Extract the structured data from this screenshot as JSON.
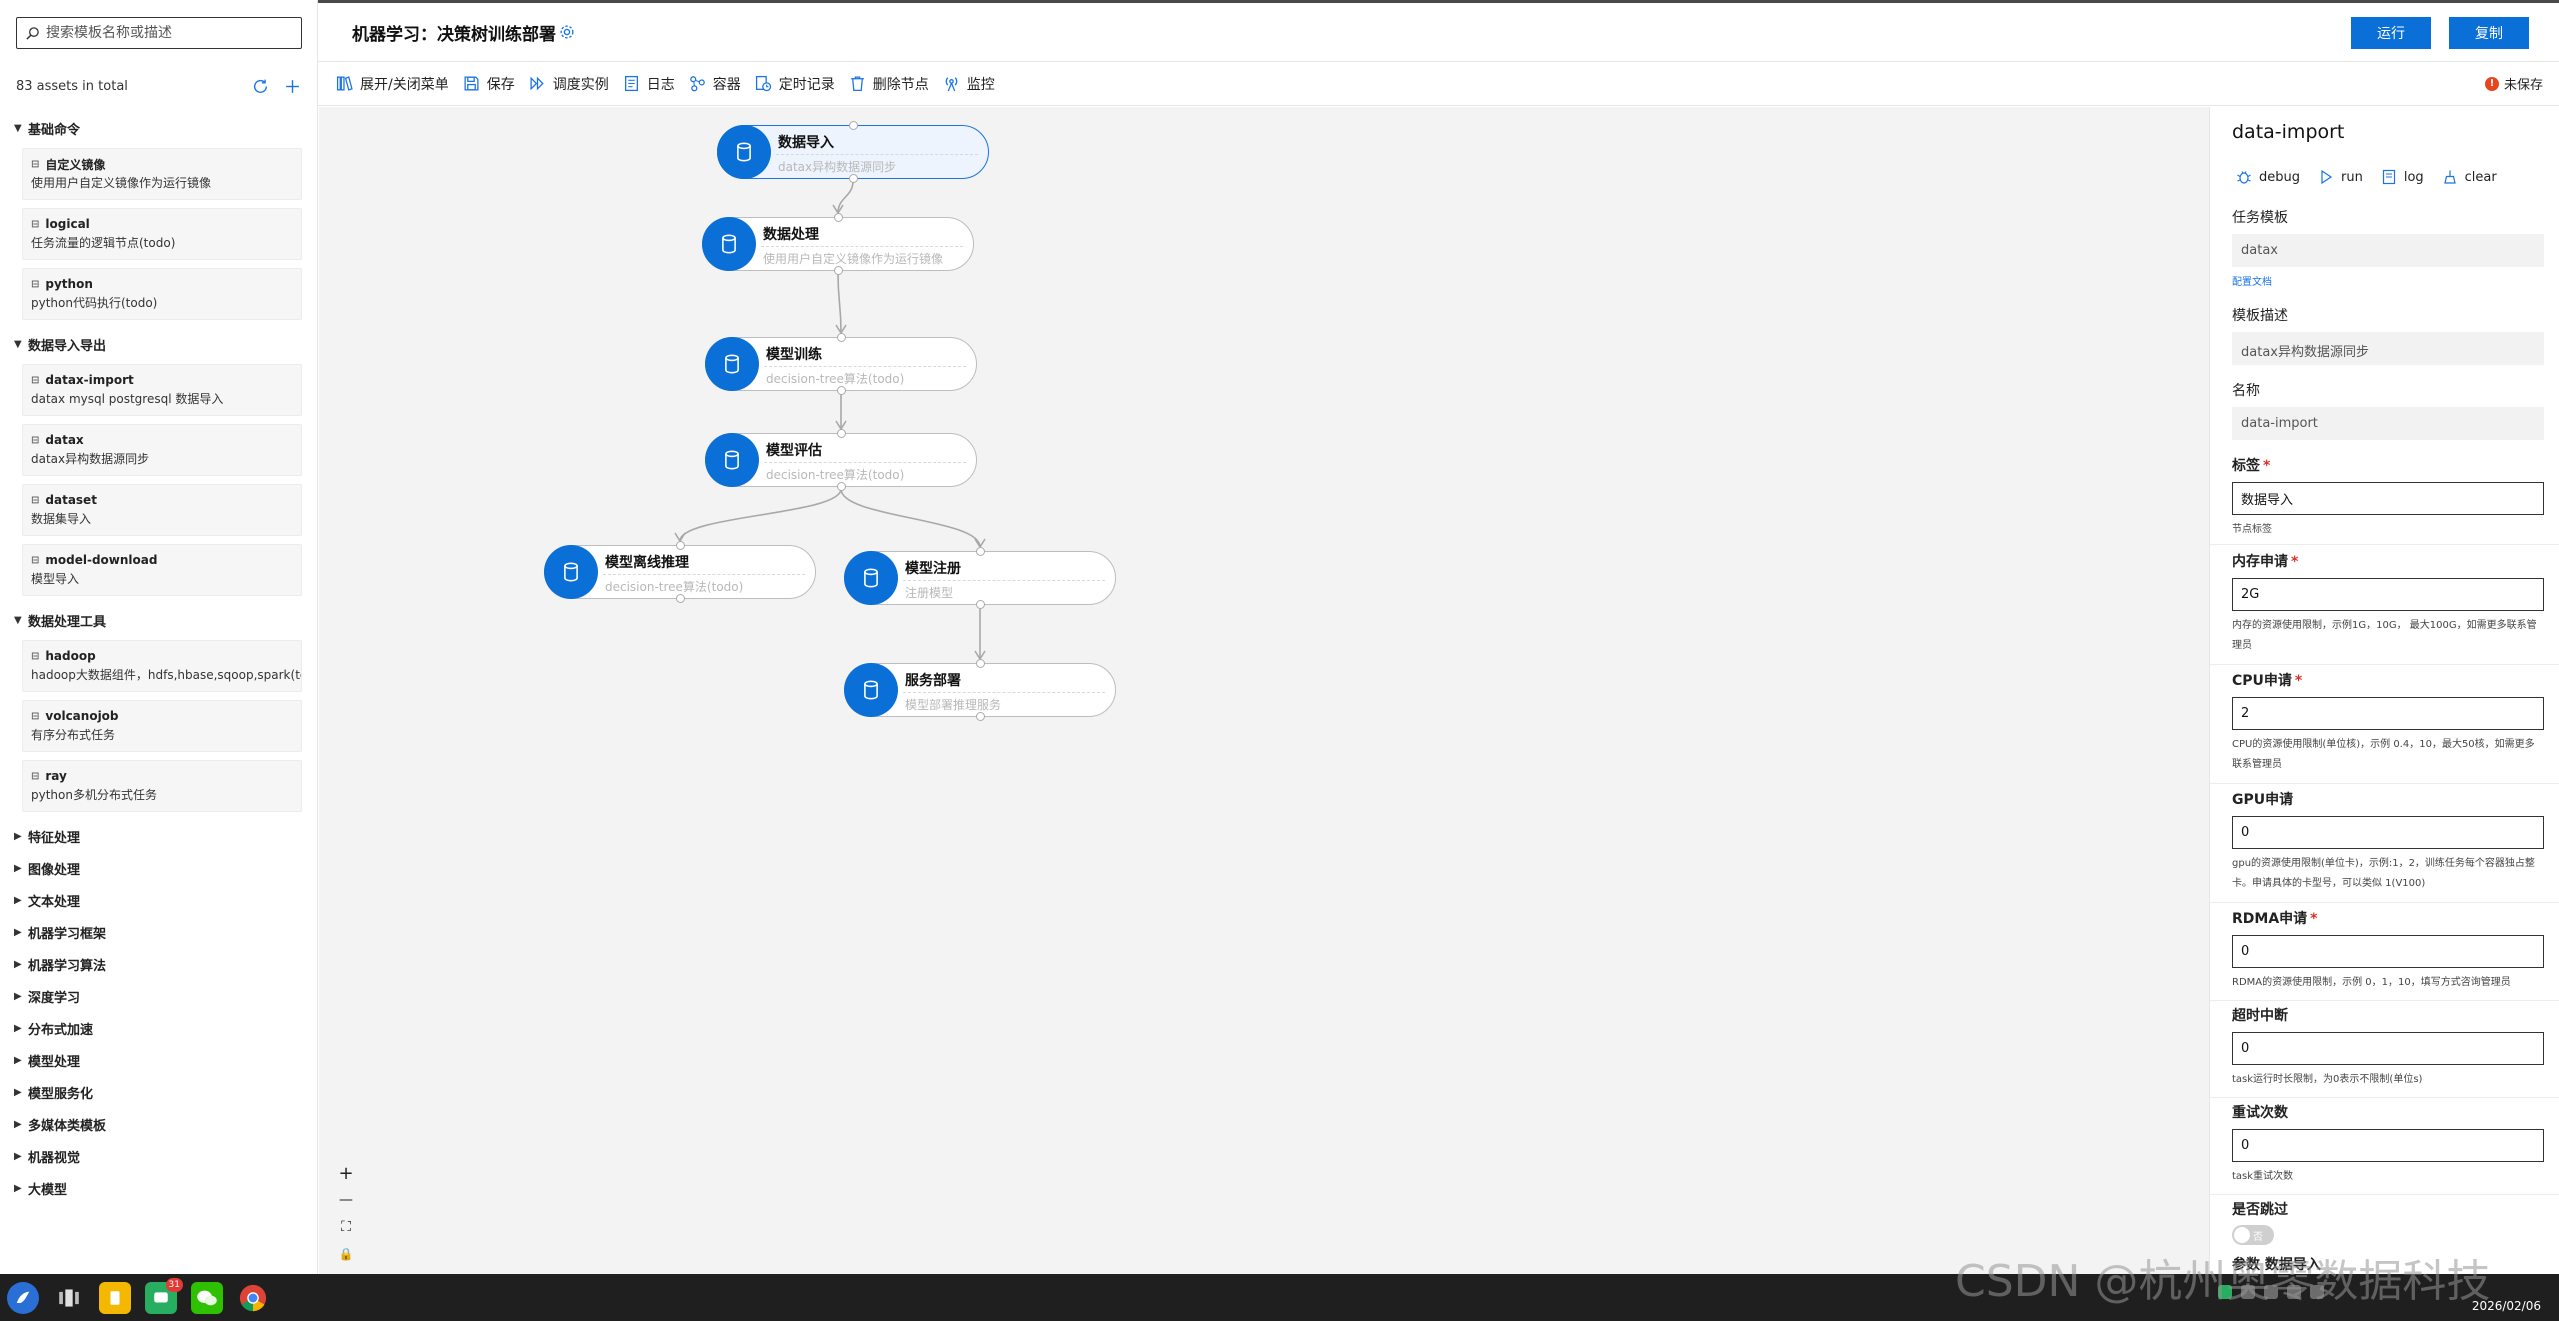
{
  "search": {
    "placeholder": "搜索模板名称或描述"
  },
  "assets": {
    "count_text": "83 assets in total"
  },
  "categories": [
    {
      "name": "基础命令",
      "expanded": true,
      "items": [
        {
          "name": "自定义镜像",
          "desc": "使用用户自定义镜像作为运行镜像"
        },
        {
          "name": "logical",
          "desc": "任务流量的逻辑节点(todo)"
        },
        {
          "name": "python",
          "desc": "python代码执行(todo)"
        }
      ]
    },
    {
      "name": "数据导入导出",
      "expanded": true,
      "items": [
        {
          "name": "datax-import",
          "desc": "datax mysql postgresql 数据导入"
        },
        {
          "name": "datax",
          "desc": "datax异构数据源同步"
        },
        {
          "name": "dataset",
          "desc": "数据集导入"
        },
        {
          "name": "model-download",
          "desc": "模型导入"
        }
      ]
    },
    {
      "name": "数据处理工具",
      "expanded": true,
      "items": [
        {
          "name": "hadoop",
          "desc": "hadoop大数据组件，hdfs,hbase,sqoop,spark(todo)"
        },
        {
          "name": "volcanojob",
          "desc": "有序分布式任务"
        },
        {
          "name": "ray",
          "desc": "python多机分布式任务"
        }
      ]
    },
    {
      "name": "特征处理",
      "expanded": false,
      "items": []
    },
    {
      "name": "图像处理",
      "expanded": false,
      "items": []
    },
    {
      "name": "文本处理",
      "expanded": false,
      "items": []
    },
    {
      "name": "机器学习框架",
      "expanded": false,
      "items": []
    },
    {
      "name": "机器学习算法",
      "expanded": false,
      "items": []
    },
    {
      "name": "深度学习",
      "expanded": false,
      "items": []
    },
    {
      "name": "分布式加速",
      "expanded": false,
      "items": []
    },
    {
      "name": "模型处理",
      "expanded": false,
      "items": []
    },
    {
      "name": "模型服务化",
      "expanded": false,
      "items": []
    },
    {
      "name": "多媒体类模板",
      "expanded": false,
      "items": []
    },
    {
      "name": "机器视觉",
      "expanded": false,
      "items": []
    },
    {
      "name": "大模型",
      "expanded": false,
      "items": []
    }
  ],
  "header": {
    "title": "机器学习：决策树训练部署",
    "run_label": "运行",
    "copy_label": "复制"
  },
  "toolbar": {
    "items": [
      {
        "label": "展开/关闭菜单",
        "icon": "books-icon"
      },
      {
        "label": "保存",
        "icon": "save-icon"
      },
      {
        "label": "调度实例",
        "icon": "forward-icon"
      },
      {
        "label": "日志",
        "icon": "log-icon"
      },
      {
        "label": "容器",
        "icon": "container-icon"
      },
      {
        "label": "定时记录",
        "icon": "timer-record-icon"
      },
      {
        "label": "删除节点",
        "icon": "trash-icon"
      },
      {
        "label": "监控",
        "icon": "monitor-icon"
      }
    ],
    "unsaved_label": "未保存"
  },
  "pipeline": {
    "nodes": [
      {
        "label": "数据导入",
        "sub": "datax异构数据源同步",
        "selected": true
      },
      {
        "label": "数据处理",
        "sub": "使用用户自定义镜像作为运行镜像",
        "selected": false
      },
      {
        "label": "模型训练",
        "sub": "decision-tree算法(todo)",
        "selected": false
      },
      {
        "label": "模型评估",
        "sub": "decision-tree算法(todo)",
        "selected": false
      },
      {
        "label": "模型离线推理",
        "sub": "decision-tree算法(todo)",
        "selected": false
      },
      {
        "label": "模型注册",
        "sub": "注册模型",
        "selected": false
      },
      {
        "label": "服务部署",
        "sub": "模型部署推理服务",
        "selected": false
      }
    ],
    "edges": [
      [
        0,
        1
      ],
      [
        1,
        2
      ],
      [
        2,
        3
      ],
      [
        3,
        4
      ],
      [
        3,
        5
      ],
      [
        5,
        6
      ]
    ]
  },
  "zoom_controls": {
    "zoom_in": "+",
    "zoom_out": "—",
    "fit": "⛶",
    "lock": "🔒"
  },
  "props": {
    "title": "data-import",
    "actions": [
      "debug",
      "run",
      "log",
      "clear"
    ],
    "template_label": "任务模板",
    "template_value": "datax",
    "doc_link": "配置文档",
    "desc_label": "模板描述",
    "desc_value": "datax异构数据源同步",
    "name_label": "名称",
    "name_value": "data-import",
    "tag_label": "标签",
    "tag_value": "数据导入",
    "tag_help": "节点标签",
    "mem_label": "内存申请",
    "mem_value": "2G",
    "mem_help": "内存的资源使用限制，示例1G，10G， 最大100G，如需更多联系管理员",
    "cpu_label": "CPU申请",
    "cpu_value": "2",
    "cpu_help": "CPU的资源使用限制(单位核)，示例 0.4，10，最大50核，如需更多联系管理员",
    "gpu_label": "GPU申请",
    "gpu_value": "0",
    "gpu_help": "gpu的资源使用限制(单位卡)，示例:1，2，训练任务每个容器独占整卡。申请具体的卡型号，可以类似 1(V100)",
    "rdma_label": "RDMA申请",
    "rdma_value": "0",
    "rdma_help": "RDMA的资源使用限制，示例 0，1，10，填写方式咨询管理员",
    "timeout_label": "超时中断",
    "timeout_value": "0",
    "timeout_help": "task运行时长限制，为0表示不限制(单位s)",
    "retry_label": "重试次数",
    "retry_value": "0",
    "retry_help": "task重试次数",
    "skip_label": "是否跳过",
    "skip_toggle": "否",
    "params_label": "参数 数据导入"
  },
  "taskbar": {
    "badge": "31",
    "date": "2026/02/06"
  },
  "watermark": "CSDN @杭州奥零数据科技"
}
